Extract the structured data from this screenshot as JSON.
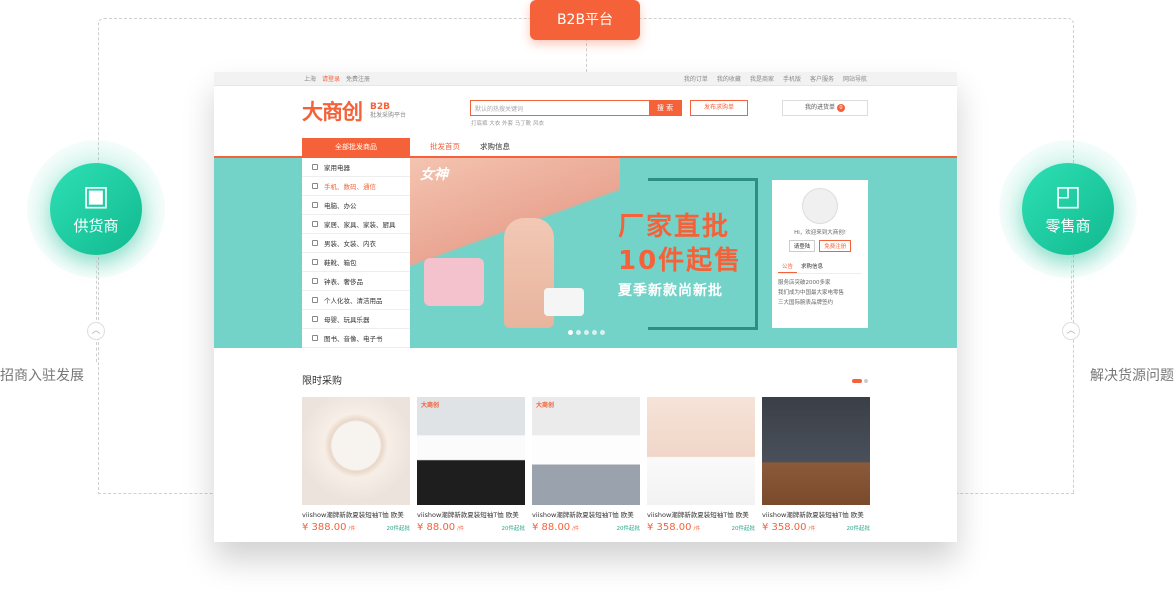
{
  "badge": "B2B平台",
  "left": {
    "label": "供货商",
    "desc": "招商入驻发展"
  },
  "right": {
    "label": "零售商",
    "desc": "解决货源问题"
  },
  "site": {
    "topbar": {
      "location": "上海",
      "login": "请登录",
      "register": "免费注册",
      "links": [
        "我的订单",
        "我的收藏",
        "我是商家",
        "手机版",
        "客户服务",
        "网站导航"
      ]
    },
    "logo": "大商创",
    "logo_tag": "B2B",
    "logo_sub": "批发采购平台",
    "search_placeholder": "默认的热搜关键词",
    "search_button": "搜 索",
    "hotwords": "打底裤  大衣  外套  马丁靴  风衣",
    "publish_button": "发布求购单",
    "cart_label": "我的进货单",
    "cart_count": "0",
    "nav_category": "全部批发商品",
    "nav_links": [
      "批发首页",
      "求购信息"
    ],
    "categories": [
      "家用电器",
      "手机、数码、通信",
      "电脑、办公",
      "家居、家具、家装、厨具",
      "男装、女装、内衣",
      "鞋靴、箱包",
      "钟表、奢侈品",
      "个人化妆、清洁用品",
      "母婴、玩具乐器",
      "图书、音像、电子书"
    ],
    "banner": {
      "brand": "女神",
      "line1": "厂家直批",
      "line2": "10件起售",
      "line3": "夏季新款尚新批"
    },
    "user": {
      "welcome": "Hi，欢迎来到大商创!",
      "login": "请登陆",
      "register": "免费注册",
      "tabs": [
        "公告",
        "求购信息"
      ],
      "notes": [
        "服务店突破2000多家",
        "我们成为中国最大家电零售",
        "三大国际腕表品牌签约"
      ]
    },
    "section_title": "限时采购",
    "products": [
      {
        "name": "viishow潮牌新款夏装短袖T恤 欧美",
        "price": "¥ 388.00",
        "unit": "/件",
        "moq": "20件起批",
        "tag": ""
      },
      {
        "name": "viishow潮牌新款夏装短袖T恤 欧美",
        "price": "¥ 88.00",
        "unit": "/件",
        "moq": "20件起批",
        "tag": "大商创"
      },
      {
        "name": "viishow潮牌新款夏装短袖T恤 欧美",
        "price": "¥ 88.00",
        "unit": "/件",
        "moq": "20件起批",
        "tag": "大商创"
      },
      {
        "name": "viishow潮牌新款夏装短袖T恤 欧美",
        "price": "¥ 358.00",
        "unit": "/件",
        "moq": "20件起批",
        "tag": ""
      },
      {
        "name": "viishow潮牌新款夏装短袖T恤 欧美",
        "price": "¥ 358.00",
        "unit": "/件",
        "moq": "20件起批",
        "tag": ""
      }
    ]
  },
  "colors": {
    "accent": "#f5623a",
    "teal": "#12b98f",
    "banner": "#74d3c8"
  }
}
